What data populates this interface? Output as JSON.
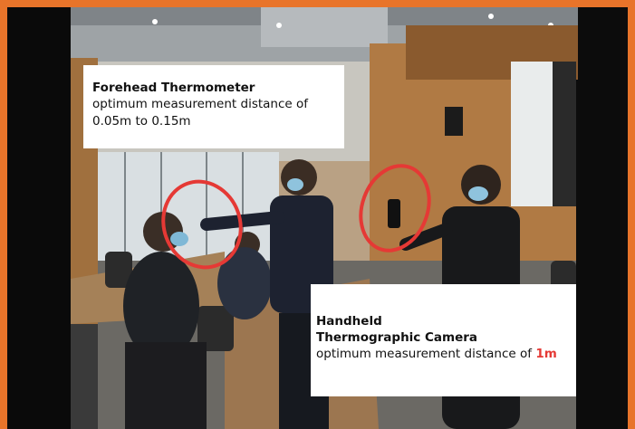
{
  "colors": {
    "border": "#e8742a",
    "annotation_circle": "#e53935",
    "label_background": "#ffffff",
    "highlight": "#e53935"
  },
  "annotations": {
    "forehead": {
      "title": "Forehead Thermometer",
      "line1": "optimum measurement distance of",
      "line2": "0.05m to 0.15m"
    },
    "handheld": {
      "title_line1": "Handheld",
      "title_line2": "Thermographic Camera",
      "desc": "optimum measurement distance of",
      "value": "1m"
    }
  }
}
